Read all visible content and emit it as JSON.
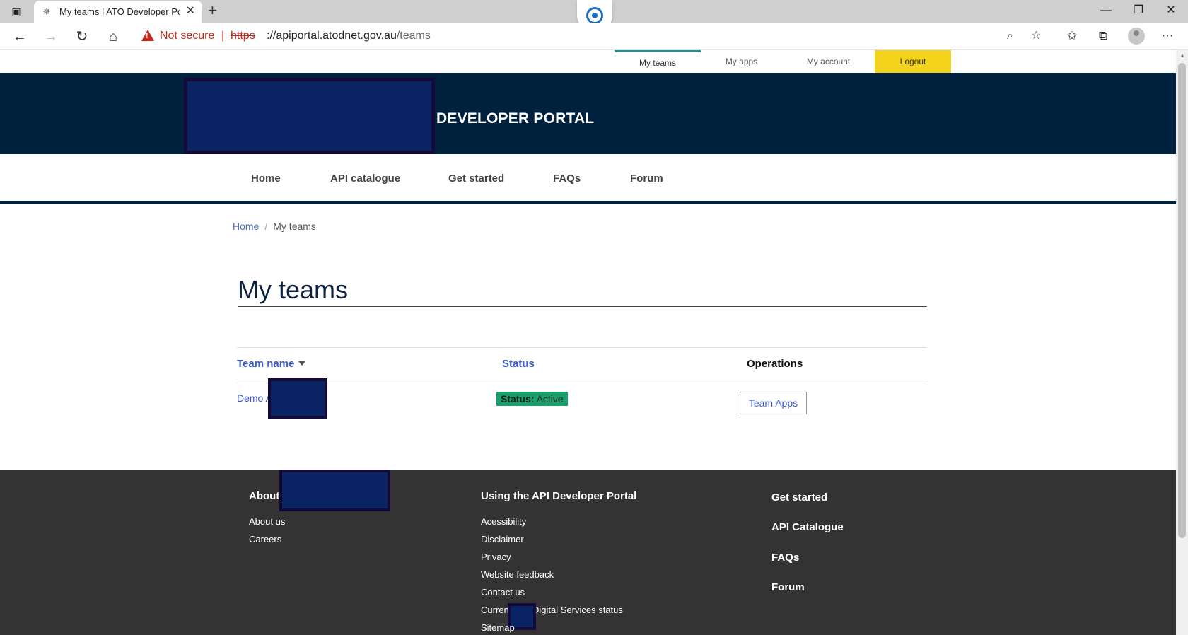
{
  "browser": {
    "tab_title": "My teams | ATO Developer Portal",
    "not_secure": "Not secure",
    "separator": "|",
    "url_scheme": "https",
    "url_rest_host": "://apiportal.atodnet.gov.au",
    "url_path": "/teams"
  },
  "utility_nav": {
    "my_teams": "My teams",
    "my_apps": "My apps",
    "my_account": "My account",
    "logout": "Logout",
    "accent_color": "#2b8a8a",
    "logout_color": "#f2d21b"
  },
  "header": {
    "title": "DEVELOPER PORTAL",
    "background": "#00213d"
  },
  "main_nav": {
    "items": [
      "Home",
      "API catalogue",
      "Get started",
      "FAQs",
      "Forum"
    ]
  },
  "breadcrumb": {
    "home": "Home",
    "separator": "/",
    "current": "My teams"
  },
  "page": {
    "title": "My teams"
  },
  "table": {
    "columns": {
      "team_name": "Team name",
      "status": "Status",
      "operations": "Operations"
    },
    "rows": [
      {
        "team_name": "Demo A",
        "status_label": "Status:",
        "status_value": "Active",
        "operation": "Team Apps"
      }
    ],
    "status_color": "#1aa06d"
  },
  "footer": {
    "about_heading": "About",
    "about_links": [
      "About us",
      "Careers"
    ],
    "using_heading": "Using the API Developer Portal",
    "using_links": [
      "Acessibility",
      "Disclaimer",
      "Privacy",
      "Website feedback",
      "Contact us",
      "Current",
      "Digital Services status",
      "Sitemap"
    ],
    "quick_links": [
      "Get started",
      "API Catalogue",
      "FAQs",
      "Forum"
    ],
    "background": "#333333"
  }
}
